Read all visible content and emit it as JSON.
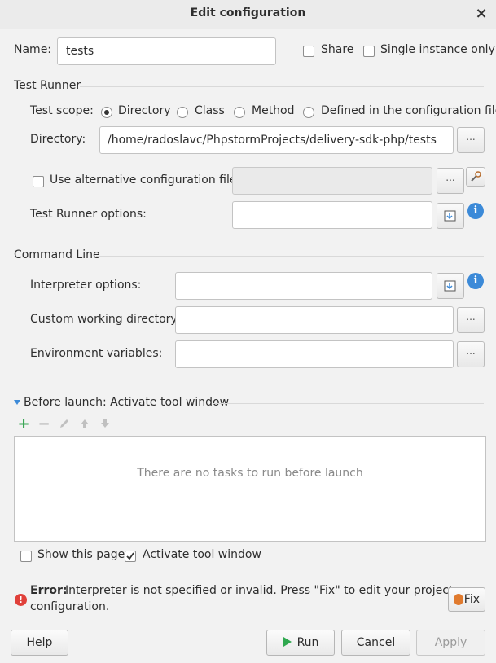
{
  "window": {
    "title": "Edit configuration",
    "close_glyph": "×"
  },
  "name_row": {
    "label": "Name:",
    "value": "tests",
    "share_label": "Share",
    "single_instance_label": "Single instance only"
  },
  "test_runner": {
    "section_label": "Test Runner",
    "scope_label": "Test scope:",
    "scopes": [
      "Directory",
      "Class",
      "Method",
      "Defined in the configuration file"
    ],
    "selected_scope": "Directory",
    "directory_label": "Directory:",
    "directory_value": "/home/radoslavc/PhpstormProjects/delivery-sdk-php/tests",
    "alt_config_label": "Use alternative configuration file:",
    "alt_config_value": "",
    "options_label": "Test Runner options:",
    "options_value": ""
  },
  "command_line": {
    "section_label": "Command Line",
    "interpreter_options_label": "Interpreter options:",
    "interpreter_options_value": "",
    "working_dir_label": "Custom working directory:",
    "working_dir_value": "",
    "env_vars_label": "Environment variables:",
    "env_vars_value": ""
  },
  "before_launch": {
    "header_label": "Before launch: Activate tool window",
    "empty_text": "There are no tasks to run before launch",
    "show_page_label": "Show this page",
    "show_page_checked": false,
    "activate_label": "Activate tool window",
    "activate_checked": true,
    "toolbar_icons": [
      "add-icon",
      "remove-icon",
      "edit-icon",
      "move-up-icon",
      "move-down-icon"
    ]
  },
  "error": {
    "prefix": "Error:",
    "message_line1": "Interpreter is not specified or invalid. Press \"Fix\" to edit your project",
    "message_line2": "configuration.",
    "fix_label": "Fix"
  },
  "footer": {
    "help_label": "Help",
    "run_label": "Run",
    "cancel_label": "Cancel",
    "apply_label": "Apply"
  },
  "buttons": {
    "browse_label": "..."
  },
  "colors": {
    "accent_blue": "#3c8ad8",
    "run_green": "#2fa84f",
    "add_green": "#3aa655",
    "error_red": "#e0403a"
  }
}
